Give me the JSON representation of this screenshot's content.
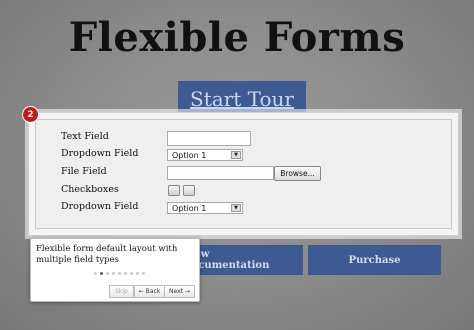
{
  "page": {
    "title": "Flexible Forms",
    "start_tour": "Start Tour",
    "view_docs": "View Documentation",
    "purchase": "Purchase"
  },
  "form": {
    "step_badge": "2",
    "text_field_label": "Text Field",
    "dropdown_field_label_1": "Dropdown Field",
    "dropdown_value_1": "Option 1",
    "file_field_label": "File Field",
    "browse_label": "Browse...",
    "checkboxes_label": "Checkboxes",
    "dropdown_field_label_2": "Dropdown Field",
    "dropdown_value_2": "Option 1"
  },
  "tooltip": {
    "text": "Flexible form default layout with multiple field types",
    "skip": "Skip",
    "back": "← Back",
    "next": "Next →",
    "step_count": 9,
    "current_step": 2
  },
  "colors": {
    "accent_button": "#3e5a92",
    "badge": "#c31b1b"
  }
}
